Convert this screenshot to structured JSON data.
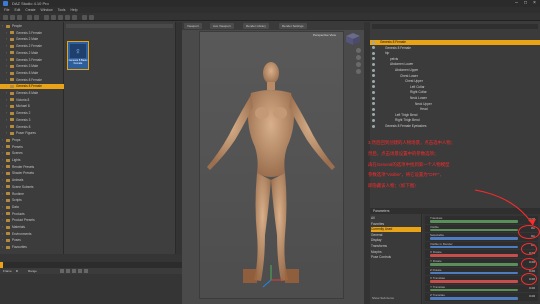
{
  "window": {
    "title": "DAZ Studio 4.10 Pro"
  },
  "menu": [
    "File",
    "Edit",
    "Create",
    "Window",
    "Tools",
    "Help"
  ],
  "left_tree": [
    {
      "label": "People",
      "depth": 0
    },
    {
      "label": "Genesis 3 Female",
      "depth": 1
    },
    {
      "label": "Genesis 2 Male",
      "depth": 1
    },
    {
      "label": "Genesis 2 Female",
      "depth": 1
    },
    {
      "label": "Genesis 2 Male",
      "depth": 1
    },
    {
      "label": "Genesis 3 Female",
      "depth": 1
    },
    {
      "label": "Genesis 3 Male",
      "depth": 1
    },
    {
      "label": "Genesis 8 Male",
      "depth": 1
    },
    {
      "label": "Genesis 8 Female",
      "depth": 1
    },
    {
      "label": "Genesis 8 Female",
      "depth": 1,
      "selected": true
    },
    {
      "label": "Genesis 8 Male",
      "depth": 1
    },
    {
      "label": "Victoria 8",
      "depth": 1
    },
    {
      "label": "Michael 8",
      "depth": 1
    },
    {
      "label": "Genesis 2",
      "depth": 1
    },
    {
      "label": "Genesis 3",
      "depth": 1
    },
    {
      "label": "Genesis 8",
      "depth": 1
    },
    {
      "label": "Poser Figures",
      "depth": 1
    },
    {
      "label": "Props",
      "depth": 0
    },
    {
      "label": "Presets",
      "depth": 0
    },
    {
      "label": "Scenes",
      "depth": 0
    },
    {
      "label": "Lights",
      "depth": 0
    },
    {
      "label": "Render Presets",
      "depth": 0
    },
    {
      "label": "Shader Presets",
      "depth": 0
    },
    {
      "label": "Animals",
      "depth": 0
    },
    {
      "label": "Scene Subsets",
      "depth": 0
    },
    {
      "label": "Runtime",
      "depth": 0
    },
    {
      "label": "Scripts",
      "depth": 0
    },
    {
      "label": "Data",
      "depth": 0
    },
    {
      "label": "Products",
      "depth": 0
    },
    {
      "label": "Product Presets",
      "depth": 0
    },
    {
      "label": "Materials",
      "depth": 0
    },
    {
      "label": "Environments",
      "depth": 0
    },
    {
      "label": "Poses",
      "depth": 0
    },
    {
      "label": "Favourites",
      "depth": 0
    }
  ],
  "content_thumb": {
    "caption": "Genesis 8 Basic Female"
  },
  "viewport": {
    "tabs": [
      "Viewport",
      "Aux Viewport",
      "Render Library",
      "Render Settings"
    ],
    "camera_button": "Perspective View"
  },
  "scene": {
    "items": [
      {
        "label": "Genesis 8 Female",
        "depth": 0,
        "selected": true
      },
      {
        "label": "Genesis 8 Female",
        "depth": 1
      },
      {
        "label": "hip",
        "depth": 1
      },
      {
        "label": "pelvis",
        "depth": 2
      },
      {
        "label": "Abdomen Lower",
        "depth": 2
      },
      {
        "label": "Abdomen Upper",
        "depth": 3
      },
      {
        "label": "Chest Lower",
        "depth": 4
      },
      {
        "label": "Chest Upper",
        "depth": 5
      },
      {
        "label": "Left Collar",
        "depth": 6
      },
      {
        "label": "Right Collar",
        "depth": 6
      },
      {
        "label": "Neck Lower",
        "depth": 6
      },
      {
        "label": "Neck Upper",
        "depth": 7
      },
      {
        "label": "Head",
        "depth": 8
      },
      {
        "label": "Left Thigh Bend",
        "depth": 3
      },
      {
        "label": "Right Thigh Bend",
        "depth": 3
      },
      {
        "label": "Genesis 8 Female Eyelashes",
        "depth": 1
      }
    ]
  },
  "annotation": {
    "lines": [
      "3.然后回到创建的人物场景，点击选中人物；",
      "然后，点击场景设置中的参数选项；",
      "再在General的选项中找到第一个人物模型",
      "参数选项“Visible”，将它设置为“OFF”，",
      "即隐藏该人物；（如下图）"
    ],
    "color": "#ff2a2a"
  },
  "parameters": {
    "tab_label": "Parameters",
    "categories": [
      {
        "label": "All"
      },
      {
        "label": "Favorites"
      },
      {
        "label": "Currently Used",
        "selected": true
      },
      {
        "label": "General"
      },
      {
        "label": "Display"
      },
      {
        "label": "Transforms"
      },
      {
        "label": "Morphs"
      },
      {
        "label": "Pose Controls"
      }
    ],
    "sliders": [
      {
        "label": "Translate",
        "value": "0.00",
        "color": "#5a8f5a"
      },
      {
        "label": "Visible",
        "value": "On",
        "color": "#5a8f5a",
        "circled": true
      },
      {
        "label": "Selectable",
        "value": "On",
        "color": "#4f7bbf"
      },
      {
        "label": "Visible in Render",
        "value": "On",
        "color": "#4f7bbf"
      },
      {
        "label": "X Rotate",
        "value": "0.00",
        "color": "#c84d4d"
      },
      {
        "label": "Y Rotate",
        "value": "0.00",
        "color": "#5a8f5a"
      },
      {
        "label": "Z Rotate",
        "value": "0.00",
        "color": "#4f7bbf"
      },
      {
        "label": "X Translate",
        "value": "0.00",
        "color": "#c84d4d"
      },
      {
        "label": "Y Translate",
        "value": "0.00",
        "color": "#5a8f5a"
      },
      {
        "label": "Z Translate",
        "value": "0.00",
        "color": "#4f7bbf"
      }
    ],
    "footer": "Show Sub Items"
  },
  "timeline": {
    "frame_label": "Frame",
    "range_label": "Range",
    "value": "0"
  },
  "colors": {
    "accent": "#e8a317",
    "annotation": "#ff2a2a"
  }
}
